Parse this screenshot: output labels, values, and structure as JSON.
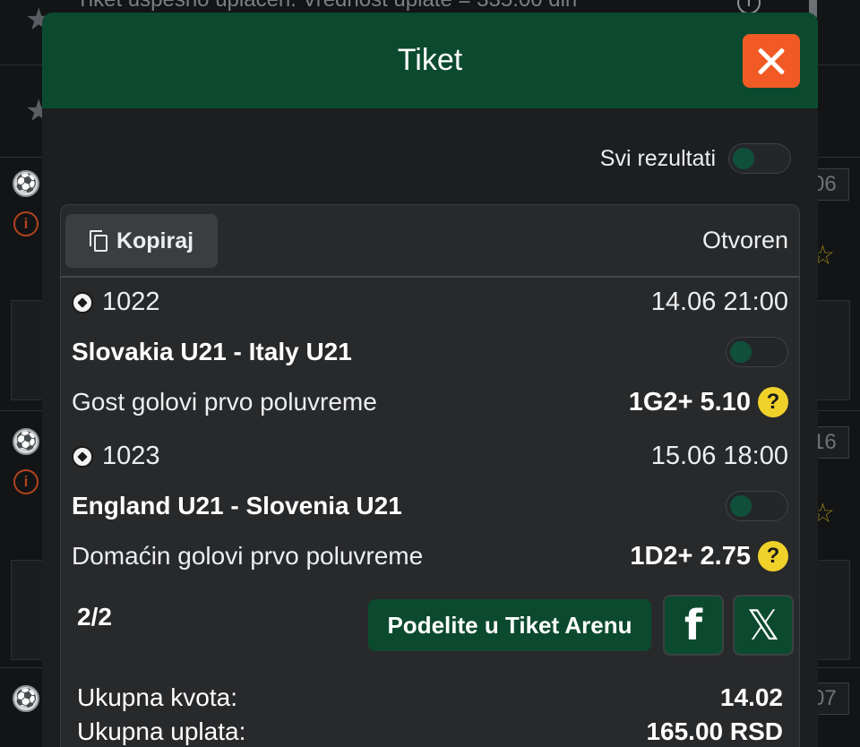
{
  "background": {
    "toast_text": "Tiket uspešno uplaćen. Vrednost uplate = 335.00 din",
    "right_numbers": [
      "06",
      "16",
      "07"
    ]
  },
  "modal": {
    "title": "Tiket",
    "show_all_label": "Svi rezultati",
    "copy_label": "Kopiraj",
    "status": "Otvoren",
    "events": [
      {
        "id": "1022",
        "datetime": "14.06 21:00",
        "teams": "Slovakia U21 - Italy U21",
        "market": "Gost golovi prvo poluvreme",
        "pick": "1G2+ 5.10"
      },
      {
        "id": "1023",
        "datetime": "15.06 18:00",
        "teams": "England U21 - Slovenia U21",
        "market": "Domaćin golovi prvo poluvreme",
        "pick": "1D2+ 2.75"
      }
    ],
    "page_indicator": "2/2",
    "share_label": "Podelite u Tiket Arenu",
    "facebook_glyph": "f",
    "x_glyph": "𝕏",
    "totals": {
      "odds_label": "Ukupna kvota:",
      "odds_value": "14.02",
      "payout_label": "Ukupna uplata:",
      "payout_value": "165.00 RSD"
    }
  },
  "colors": {
    "header_green": "#0c4a2f",
    "close_orange": "#f15a24",
    "help_yellow": "#f0d12a"
  }
}
